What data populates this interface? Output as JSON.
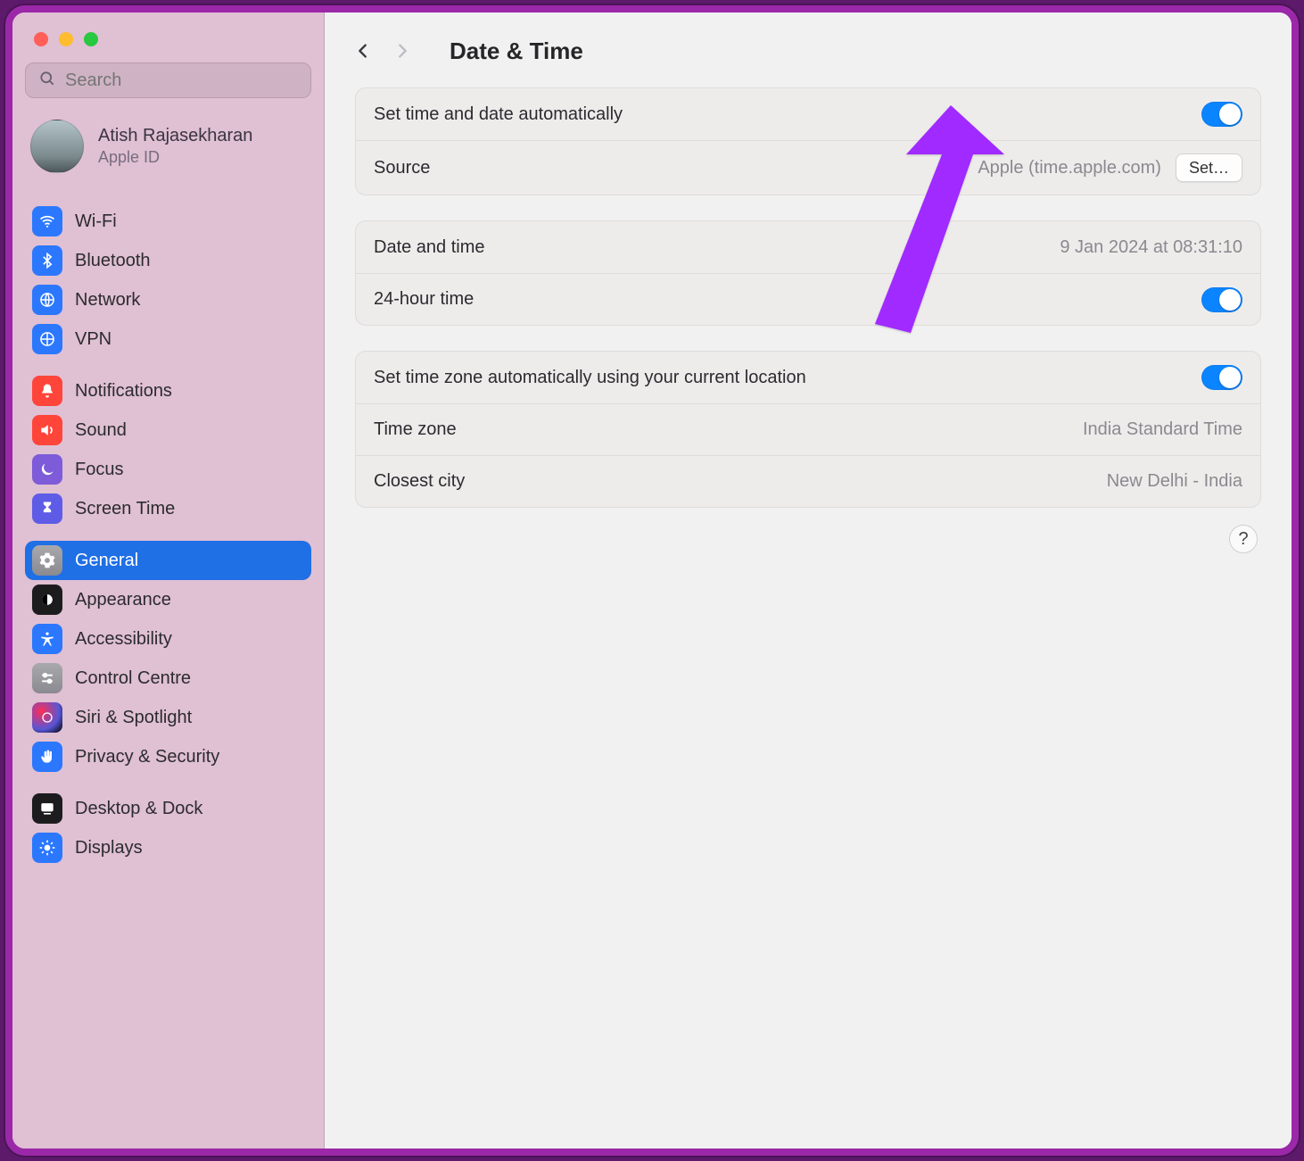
{
  "header": {
    "title": "Date & Time"
  },
  "search": {
    "placeholder": "Search"
  },
  "account": {
    "name": "Atish Rajasekharan",
    "sub": "Apple ID"
  },
  "sidebar": {
    "groups": [
      {
        "items": [
          {
            "label": "Wi-Fi"
          },
          {
            "label": "Bluetooth"
          },
          {
            "label": "Network"
          },
          {
            "label": "VPN"
          }
        ]
      },
      {
        "items": [
          {
            "label": "Notifications"
          },
          {
            "label": "Sound"
          },
          {
            "label": "Focus"
          },
          {
            "label": "Screen Time"
          }
        ]
      },
      {
        "items": [
          {
            "label": "General",
            "selected": true
          },
          {
            "label": "Appearance"
          },
          {
            "label": "Accessibility"
          },
          {
            "label": "Control Centre"
          },
          {
            "label": "Siri & Spotlight"
          },
          {
            "label": "Privacy & Security"
          }
        ]
      },
      {
        "items": [
          {
            "label": "Desktop & Dock"
          },
          {
            "label": "Displays"
          }
        ]
      }
    ]
  },
  "main": {
    "card1": {
      "auto_label": "Set time and date automatically",
      "source_label": "Source",
      "source_value": "Apple (time.apple.com)",
      "source_button": "Set…"
    },
    "card2": {
      "dt_label": "Date and time",
      "dt_value": "9 Jan 2024 at 08:31:10",
      "h24_label": "24-hour time"
    },
    "card3": {
      "tz_auto_label": "Set time zone automatically using your current location",
      "tz_label": "Time zone",
      "tz_value": "India Standard Time",
      "city_label": "Closest city",
      "city_value": "New Delhi - India"
    }
  },
  "help": "?"
}
